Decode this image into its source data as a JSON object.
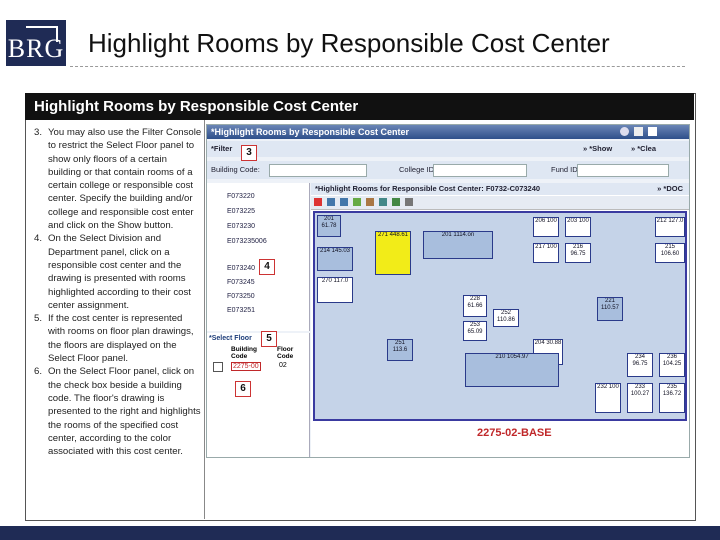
{
  "header": {
    "logo_text": "BRG",
    "title": "Highlight Rooms by Responsible Cost Center"
  },
  "frame": {
    "heading": "Highlight Rooms by Responsible Cost Center"
  },
  "steps": [
    {
      "num": "3.",
      "text": "You may also use the Filter Console to restrict the Select Floor panel to show only floors of a certain building or that contain rooms of a certain college or responsible cost center. Specify the building and/or college and responsible cost enter and click on the Show button."
    },
    {
      "num": "4.",
      "text": "On the Select Division and Department panel, click on a responsible cost center and the drawing is presented with rooms highlighted according to their cost center assignment."
    },
    {
      "num": "5.",
      "text": "If the cost center is represented with rooms on floor plan drawings, the floors are displayed on the Select Floor panel."
    },
    {
      "num": "6.",
      "text": "On the Select Floor panel, click on the check box beside a building code. The floor's drawing is presented to the right and highlights the rooms of the specified cost center, according to the color associated with this cost center."
    }
  ],
  "app": {
    "title": "*Highlight Rooms by Responsible Cost Center",
    "filter_label": "*Filter",
    "show_label": "» *Show",
    "clear_label": "» *Clea",
    "building_code_label": "Building Code:",
    "college_label": "College ID:",
    "fund_label": "Fund ID:",
    "drawing_title": "*Highlight Rooms for Responsible Cost Center: F0732-C073240",
    "doc_label": "» *DOC",
    "select_floor_label": "*Select Floor",
    "col_building": "Building Code",
    "col_floor": "Floor Code",
    "floor_row": {
      "building": "2275-00",
      "floor": "02"
    },
    "tree": [
      "F073220",
      "E073225",
      "E073230",
      "E073235006",
      "E073240",
      "F073245",
      "F073250",
      "E073251"
    ],
    "floor_label": "2275-02-BASE"
  },
  "callouts": [
    "3",
    "4",
    "5",
    "6"
  ],
  "rooms": [
    {
      "label": "201 61.78"
    },
    {
      "label": "271 448.61"
    },
    {
      "label": "201 1114.on"
    },
    {
      "label": "214 145.03"
    },
    {
      "label": "270 117.0"
    },
    {
      "label": "206 100"
    },
    {
      "label": "203 100"
    },
    {
      "label": "212 127.0"
    },
    {
      "label": "216 96.75"
    },
    {
      "label": "217 100"
    },
    {
      "label": "215 106.60"
    },
    {
      "label": "221 110.57"
    },
    {
      "label": "228 61.66"
    },
    {
      "label": "252 110.86"
    },
    {
      "label": "253 65.09"
    },
    {
      "label": "251 113.6"
    },
    {
      "label": "204 30.88"
    },
    {
      "label": "232 100"
    },
    {
      "label": "233 100.27"
    },
    {
      "label": "235 136.72"
    },
    {
      "label": "210 1054.97"
    },
    {
      "label": "234 96.75"
    },
    {
      "label": "236 104.25"
    }
  ],
  "colors": {
    "highlight": "#f2ec18",
    "room": "#a8bedd",
    "brand": "#1f2b55"
  }
}
